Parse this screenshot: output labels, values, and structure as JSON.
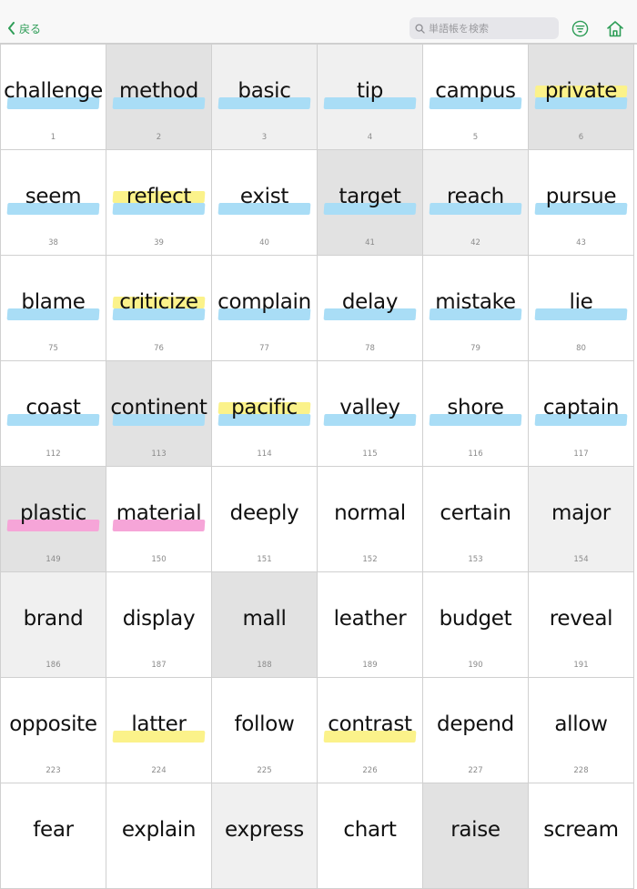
{
  "header": {
    "back_label": "戻る",
    "search_placeholder": "単語帳を検索",
    "accent_color": "#2e9d57",
    "icons": [
      "chevron-left-icon",
      "search-icon",
      "filter-icon",
      "home-icon"
    ]
  },
  "highlight_colors": {
    "blue": "#a9ddf6",
    "yellow": "#fbf28a",
    "pink": "#f6a5d8"
  },
  "cards": [
    {
      "word": "challenge",
      "number": "1",
      "bg": "white",
      "hl": [
        "blue"
      ]
    },
    {
      "word": "method",
      "number": "2",
      "bg": "gray",
      "hl": [
        "blue"
      ]
    },
    {
      "word": "basic",
      "number": "3",
      "bg": "lightgray",
      "hl": [
        "blue"
      ]
    },
    {
      "word": "tip",
      "number": "4",
      "bg": "lightgray",
      "hl": [
        "blue"
      ]
    },
    {
      "word": "campus",
      "number": "5",
      "bg": "white",
      "hl": [
        "blue"
      ]
    },
    {
      "word": "private",
      "number": "6",
      "bg": "gray",
      "hl": [
        "yellow",
        "blue"
      ]
    },
    {
      "word": "seem",
      "number": "38",
      "bg": "white",
      "hl": [
        "blue"
      ]
    },
    {
      "word": "reflect",
      "number": "39",
      "bg": "white",
      "hl": [
        "yellow",
        "blue"
      ]
    },
    {
      "word": "exist",
      "number": "40",
      "bg": "white",
      "hl": [
        "blue"
      ]
    },
    {
      "word": "target",
      "number": "41",
      "bg": "gray",
      "hl": [
        "blue"
      ]
    },
    {
      "word": "reach",
      "number": "42",
      "bg": "lightgray",
      "hl": [
        "blue"
      ]
    },
    {
      "word": "pursue",
      "number": "43",
      "bg": "white",
      "hl": [
        "blue"
      ]
    },
    {
      "word": "blame",
      "number": "75",
      "bg": "white",
      "hl": [
        "blue"
      ]
    },
    {
      "word": "criticize",
      "number": "76",
      "bg": "white",
      "hl": [
        "yellow",
        "blue"
      ]
    },
    {
      "word": "complain",
      "number": "77",
      "bg": "white",
      "hl": [
        "blue"
      ]
    },
    {
      "word": "delay",
      "number": "78",
      "bg": "white",
      "hl": [
        "blue"
      ]
    },
    {
      "word": "mistake",
      "number": "79",
      "bg": "white",
      "hl": [
        "blue"
      ]
    },
    {
      "word": "lie",
      "number": "80",
      "bg": "white",
      "hl": [
        "blue"
      ]
    },
    {
      "word": "coast",
      "number": "112",
      "bg": "white",
      "hl": [
        "blue"
      ]
    },
    {
      "word": "continent",
      "number": "113",
      "bg": "gray",
      "hl": [
        "blue"
      ]
    },
    {
      "word": "pacific",
      "number": "114",
      "bg": "white",
      "hl": [
        "yellow",
        "blue"
      ]
    },
    {
      "word": "valley",
      "number": "115",
      "bg": "white",
      "hl": [
        "blue"
      ]
    },
    {
      "word": "shore",
      "number": "116",
      "bg": "white",
      "hl": [
        "blue"
      ]
    },
    {
      "word": "captain",
      "number": "117",
      "bg": "white",
      "hl": [
        "blue"
      ]
    },
    {
      "word": "plastic",
      "number": "149",
      "bg": "gray",
      "hl": [
        "pink"
      ]
    },
    {
      "word": "material",
      "number": "150",
      "bg": "white",
      "hl": [
        "pink"
      ]
    },
    {
      "word": "deeply",
      "number": "151",
      "bg": "white",
      "hl": []
    },
    {
      "word": "normal",
      "number": "152",
      "bg": "white",
      "hl": []
    },
    {
      "word": "certain",
      "number": "153",
      "bg": "white",
      "hl": []
    },
    {
      "word": "major",
      "number": "154",
      "bg": "lightgray",
      "hl": []
    },
    {
      "word": "brand",
      "number": "186",
      "bg": "lightgray",
      "hl": []
    },
    {
      "word": "display",
      "number": "187",
      "bg": "white",
      "hl": []
    },
    {
      "word": "mall",
      "number": "188",
      "bg": "gray",
      "hl": []
    },
    {
      "word": "leather",
      "number": "189",
      "bg": "white",
      "hl": []
    },
    {
      "word": "budget",
      "number": "190",
      "bg": "white",
      "hl": []
    },
    {
      "word": "reveal",
      "number": "191",
      "bg": "white",
      "hl": []
    },
    {
      "word": "opposite",
      "number": "223",
      "bg": "white",
      "hl": []
    },
    {
      "word": "latter",
      "number": "224",
      "bg": "white",
      "hl": [
        "yellow"
      ]
    },
    {
      "word": "follow",
      "number": "225",
      "bg": "white",
      "hl": []
    },
    {
      "word": "contrast",
      "number": "226",
      "bg": "white",
      "hl": [
        "yellow"
      ]
    },
    {
      "word": "depend",
      "number": "227",
      "bg": "white",
      "hl": []
    },
    {
      "word": "allow",
      "number": "228",
      "bg": "white",
      "hl": []
    },
    {
      "word": "fear",
      "number": "",
      "bg": "white",
      "hl": []
    },
    {
      "word": "explain",
      "number": "",
      "bg": "white",
      "hl": []
    },
    {
      "word": "express",
      "number": "",
      "bg": "lightgray",
      "hl": []
    },
    {
      "word": "chart",
      "number": "",
      "bg": "white",
      "hl": []
    },
    {
      "word": "raise",
      "number": "",
      "bg": "gray",
      "hl": []
    },
    {
      "word": "scream",
      "number": "",
      "bg": "white",
      "hl": []
    }
  ]
}
